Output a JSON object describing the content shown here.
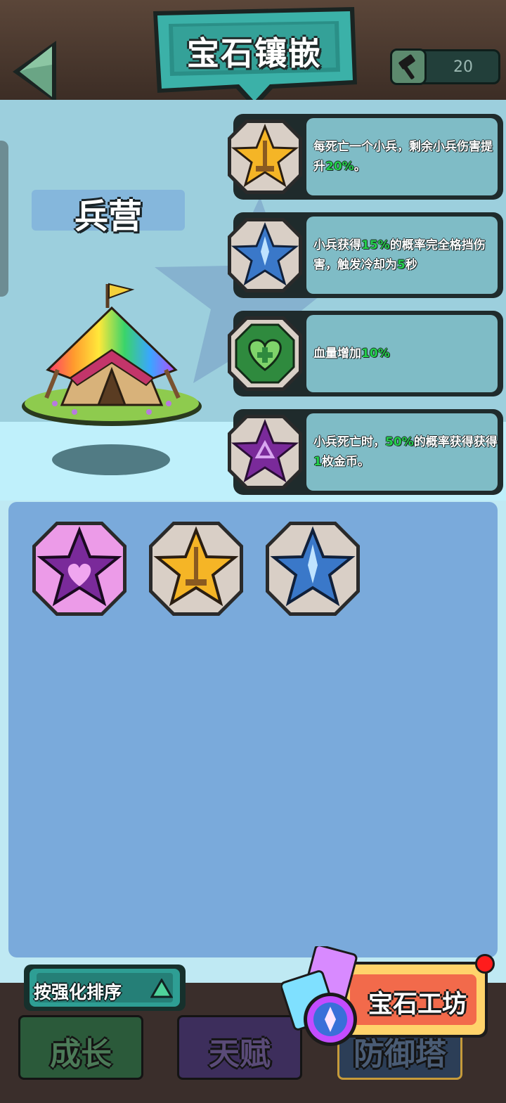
{
  "header": {
    "title": "宝石镶嵌",
    "hammer_count": "20"
  },
  "building": {
    "name": "兵营"
  },
  "effects": [
    {
      "icon": "gold-sword-star-gem",
      "parts": [
        {
          "text": "每死亡一个小兵，剩余小兵伤害提升"
        },
        {
          "text": "20%",
          "highlight": true
        },
        {
          "text": "。"
        }
      ]
    },
    {
      "icon": "blue-ice-star-gem",
      "parts": [
        {
          "text": "小兵获得"
        },
        {
          "text": "15%",
          "highlight": true
        },
        {
          "text": "的概率完全格挡伤害，触发冷却为"
        },
        {
          "text": "5",
          "highlight": true
        },
        {
          "text": "秒"
        }
      ]
    },
    {
      "icon": "green-heart-gem",
      "parts": [
        {
          "text": "血量增加"
        },
        {
          "text": "10%",
          "highlight": true
        }
      ]
    },
    {
      "icon": "purple-recycle-star-gem",
      "parts": [
        {
          "text": "小兵死亡时，"
        },
        {
          "text": "50%",
          "highlight": true
        },
        {
          "text": "的概率获得获得"
        },
        {
          "text": "1",
          "highlight": true
        },
        {
          "text": "枚金币。"
        }
      ]
    }
  ],
  "inventory": [
    {
      "icon": "purple-fang-heart-star-gem",
      "selected": true
    },
    {
      "icon": "gold-sword-star-gem",
      "selected": false
    },
    {
      "icon": "blue-ice-star-gem",
      "selected": false
    }
  ],
  "sort_button": {
    "label": "按强化排序"
  },
  "workshop_button": {
    "label": "宝石工坊",
    "has_notification": true
  },
  "tabs": [
    {
      "label": "成长"
    },
    {
      "label": "天赋"
    },
    {
      "label": "防御塔",
      "active": true
    }
  ],
  "colors": {
    "highlight": "#22d04a",
    "title_teal": "#3bb1a8",
    "inventory_bg": "#7aaadb",
    "gold": "#f5b526",
    "blue": "#3a78c9",
    "purple": "#7a2a9a",
    "green": "#2f8a3e"
  }
}
